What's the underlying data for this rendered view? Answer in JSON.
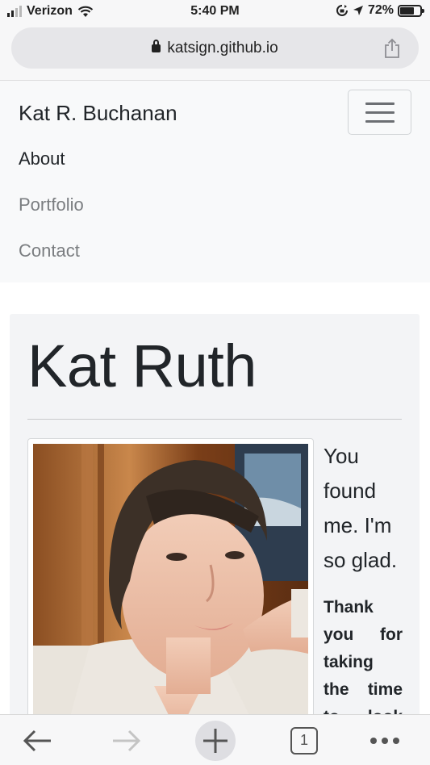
{
  "status_bar": {
    "carrier": "Verizon",
    "time": "5:40 PM",
    "battery": "72%",
    "battery_level": 0.72,
    "icons": [
      "signal-icon",
      "wifi-icon",
      "orientation-lock-icon",
      "location-icon",
      "battery-icon"
    ]
  },
  "browser": {
    "url": "katsign.github.io",
    "tab_count": "1",
    "toolbar_icons": [
      "back-arrow-icon",
      "forward-arrow-icon",
      "new-tab-plus-icon",
      "tabs-icon",
      "more-icon",
      "share-icon",
      "lock-icon"
    ]
  },
  "navbar": {
    "brand": "Kat R. Buchanan",
    "links": [
      {
        "label": "About",
        "active": true
      },
      {
        "label": "Portfolio",
        "active": false
      },
      {
        "label": "Contact",
        "active": false
      }
    ]
  },
  "hero": {
    "title": "Kat Ruth",
    "lead": "You found me. I'm so glad.",
    "body": "Thank you for taking the time to look"
  },
  "colors": {
    "navbar_bg": "#f8f9fa",
    "card_bg": "#f3f4f6",
    "text": "#212529",
    "muted_link": "#7a7d80"
  }
}
